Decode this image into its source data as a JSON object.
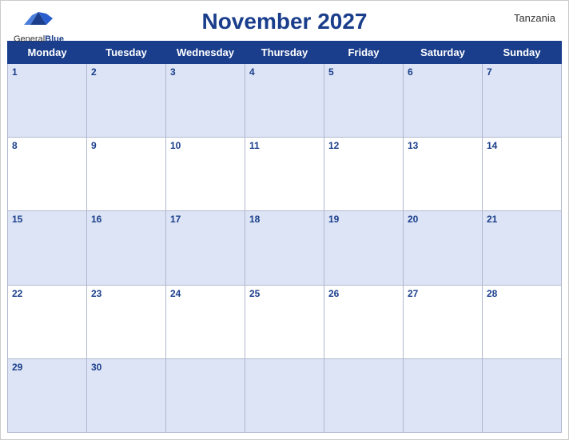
{
  "header": {
    "title": "November 2027",
    "country": "Tanzania",
    "logo": {
      "general": "General",
      "blue": "Blue"
    }
  },
  "days_of_week": [
    "Monday",
    "Tuesday",
    "Wednesday",
    "Thursday",
    "Friday",
    "Saturday",
    "Sunday"
  ],
  "weeks": [
    [
      {
        "day": 1
      },
      {
        "day": 2
      },
      {
        "day": 3
      },
      {
        "day": 4
      },
      {
        "day": 5
      },
      {
        "day": 6
      },
      {
        "day": 7
      }
    ],
    [
      {
        "day": 8
      },
      {
        "day": 9
      },
      {
        "day": 10
      },
      {
        "day": 11
      },
      {
        "day": 12
      },
      {
        "day": 13
      },
      {
        "day": 14
      }
    ],
    [
      {
        "day": 15
      },
      {
        "day": 16
      },
      {
        "day": 17
      },
      {
        "day": 18
      },
      {
        "day": 19
      },
      {
        "day": 20
      },
      {
        "day": 21
      }
    ],
    [
      {
        "day": 22
      },
      {
        "day": 23
      },
      {
        "day": 24
      },
      {
        "day": 25
      },
      {
        "day": 26
      },
      {
        "day": 27
      },
      {
        "day": 28
      }
    ],
    [
      {
        "day": 29
      },
      {
        "day": 30
      },
      {
        "day": null
      },
      {
        "day": null
      },
      {
        "day": null
      },
      {
        "day": null
      },
      {
        "day": null
      }
    ]
  ],
  "colors": {
    "header_bg": "#1a3e8c",
    "row_odd_bg": "#dce4f5",
    "row_even_bg": "#ffffff",
    "text_blue": "#1a3e8c"
  }
}
